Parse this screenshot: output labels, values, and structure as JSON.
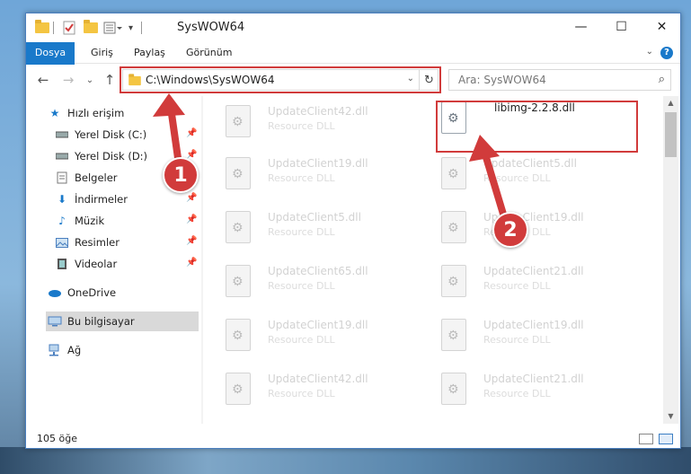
{
  "window": {
    "title": "SysWOW64",
    "controls": {
      "minimize": "—",
      "maximize": "☐",
      "close": "✕"
    }
  },
  "ribbon": {
    "tabs": [
      "Dosya",
      "Giriş",
      "Paylaş",
      "Görünüm"
    ],
    "help": "?"
  },
  "navigation": {
    "address": "C:\\Windows\\SysWOW64",
    "search_placeholder": "Ara: SysWOW64"
  },
  "sidebar": {
    "items": [
      {
        "label": "Hızlı erişim",
        "icon": "star-icon"
      },
      {
        "label": "Yerel Disk (C:)",
        "icon": "drive-icon",
        "pinned": true
      },
      {
        "label": "Yerel Disk (D:)",
        "icon": "drive-icon",
        "pinned": true
      },
      {
        "label": "Belgeler",
        "icon": "documents-icon",
        "pinned": true
      },
      {
        "label": "İndirmeler",
        "icon": "download-icon",
        "pinned": true
      },
      {
        "label": "Müzik",
        "icon": "music-icon",
        "pinned": true
      },
      {
        "label": "Resimler",
        "icon": "pictures-icon",
        "pinned": true
      },
      {
        "label": "Videolar",
        "icon": "videos-icon",
        "pinned": true
      },
      {
        "label": "OneDrive",
        "icon": "cloud-icon"
      },
      {
        "label": "Bu bilgisayar",
        "icon": "computer-icon",
        "selected": true
      },
      {
        "label": "Ağ",
        "icon": "network-icon"
      }
    ]
  },
  "files": [
    {
      "name": "UpdateClient42.dll",
      "type": "Resource DLL"
    },
    {
      "name": "libimg-2.2.8.dll",
      "type": ""
    },
    {
      "name": "UpdateClient19.dll",
      "type": "Resource DLL"
    },
    {
      "name": "UpdateClient5.dll",
      "type": "Resource DLL"
    },
    {
      "name": "UpdateClient5.dll",
      "type": "Resource DLL"
    },
    {
      "name": "UpdateClient19.dll",
      "type": "Resource DLL"
    },
    {
      "name": "UpdateClient65.dll",
      "type": "Resource DLL"
    },
    {
      "name": "UpdateClient21.dll",
      "type": "Resource DLL"
    },
    {
      "name": "UpdateClient19.dll",
      "type": "Resource DLL"
    },
    {
      "name": "UpdateClient19.dll",
      "type": "Resource DLL"
    },
    {
      "name": "UpdateClient42.dll",
      "type": "Resource DLL"
    },
    {
      "name": "UpdateClient21.dll",
      "type": "Resource DLL"
    }
  ],
  "status": {
    "count": "105 öğe"
  },
  "annotations": {
    "step1": "1",
    "step2": "2",
    "color": "#d13b3b"
  }
}
